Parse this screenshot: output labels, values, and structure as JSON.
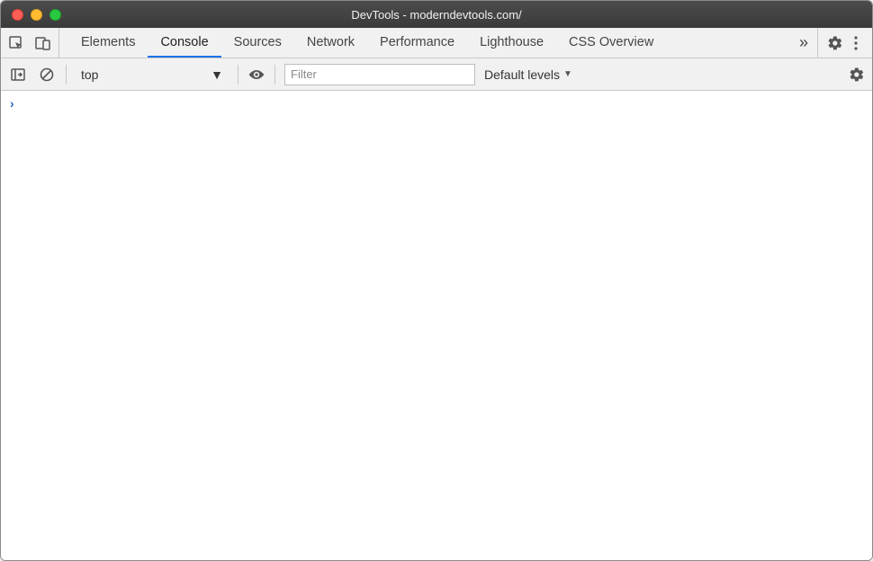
{
  "window": {
    "title": "DevTools - moderndevtools.com/"
  },
  "tabs": {
    "items": [
      {
        "label": "Elements"
      },
      {
        "label": "Console"
      },
      {
        "label": "Sources"
      },
      {
        "label": "Network"
      },
      {
        "label": "Performance"
      },
      {
        "label": "Lighthouse"
      },
      {
        "label": "CSS Overview"
      }
    ],
    "active_index": 1,
    "overflow_glyph": "»"
  },
  "toolbar": {
    "context_label": "top",
    "filter_placeholder": "Filter",
    "levels_label": "Default levels"
  },
  "prompt_glyph": "›"
}
